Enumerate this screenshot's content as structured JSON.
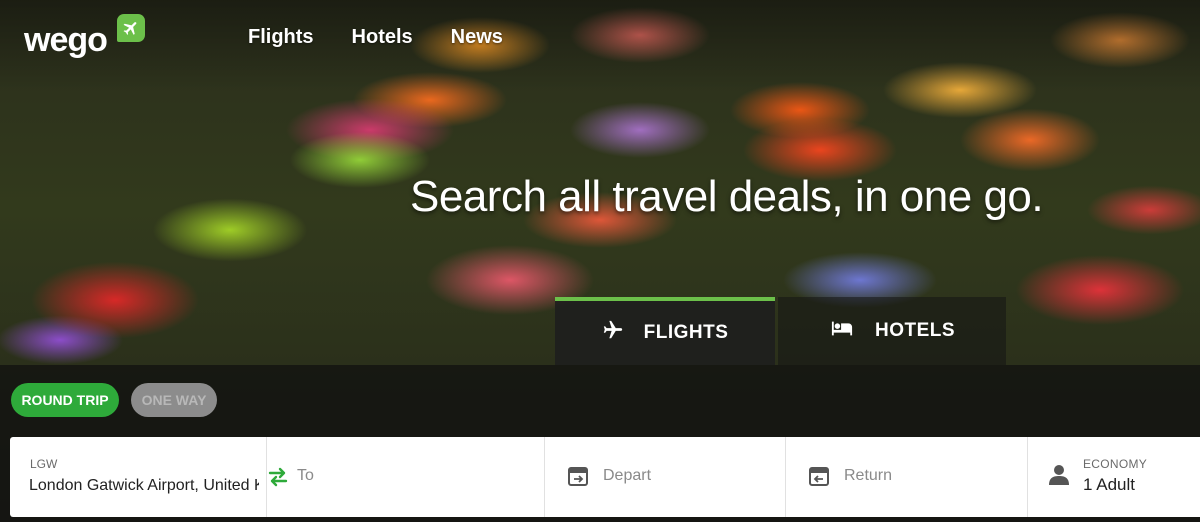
{
  "brand": {
    "logo_text": "wego",
    "accent_color": "#6cc04a"
  },
  "nav": {
    "items": [
      "Flights",
      "Hotels",
      "News"
    ]
  },
  "hero": {
    "headline": "Search all travel deals, in one go."
  },
  "tabs": [
    {
      "label": "FLIGHTS",
      "icon": "airplane-icon",
      "active": true
    },
    {
      "label": "HOTELS",
      "icon": "bed-icon",
      "active": false
    }
  ],
  "trip_type": {
    "round_trip": "ROUND TRIP",
    "one_way": "ONE WAY",
    "selected": "ROUND TRIP"
  },
  "search": {
    "from": {
      "code": "LGW",
      "value": "London Gatwick Airport, United Kingdom"
    },
    "to": {
      "placeholder": "To"
    },
    "depart": {
      "placeholder": "Depart"
    },
    "return": {
      "placeholder": "Return"
    },
    "passengers": {
      "cabin_class": "ECONOMY",
      "count": "1 Adult"
    }
  },
  "colors": {
    "round_trip_active": "#2eaa3a",
    "one_way_inactive": "#8c8c8c",
    "swap_icon": "#2eaa3a"
  }
}
